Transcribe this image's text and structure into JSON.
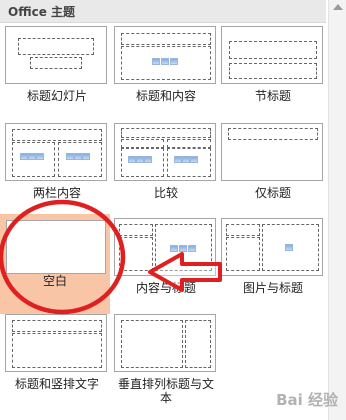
{
  "header": {
    "title": "Office 主题"
  },
  "layouts": [
    {
      "label": "标题幻灯片"
    },
    {
      "label": "标题和内容"
    },
    {
      "label": "节标题"
    },
    {
      "label": "两栏内容"
    },
    {
      "label": "比较"
    },
    {
      "label": "仅标题"
    },
    {
      "label": "空白"
    },
    {
      "label": "内容与标题"
    },
    {
      "label": "图片与标题"
    },
    {
      "label": "标题和竖排文字"
    },
    {
      "label": "垂直排列标题与文本"
    }
  ],
  "annotations": {
    "circle_color": "#e02020",
    "arrow_color": "#e02020"
  },
  "watermark": {
    "text": "Bai 经验"
  }
}
